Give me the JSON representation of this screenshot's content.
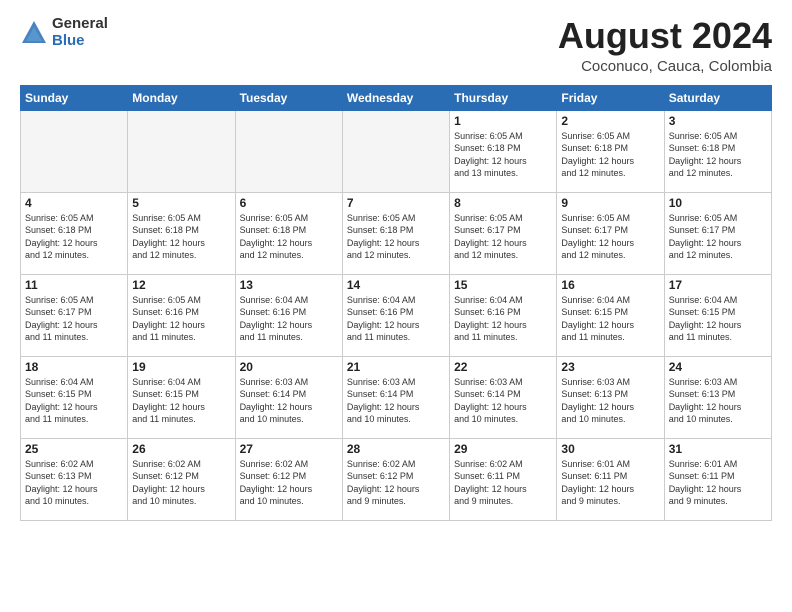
{
  "logo": {
    "general": "General",
    "blue": "Blue"
  },
  "title": "August 2024",
  "location": "Coconuco, Cauca, Colombia",
  "weekdays": [
    "Sunday",
    "Monday",
    "Tuesday",
    "Wednesday",
    "Thursday",
    "Friday",
    "Saturday"
  ],
  "weeks": [
    [
      {
        "day": "",
        "text": ""
      },
      {
        "day": "",
        "text": ""
      },
      {
        "day": "",
        "text": ""
      },
      {
        "day": "",
        "text": ""
      },
      {
        "day": "1",
        "text": "Sunrise: 6:05 AM\nSunset: 6:18 PM\nDaylight: 12 hours\nand 13 minutes."
      },
      {
        "day": "2",
        "text": "Sunrise: 6:05 AM\nSunset: 6:18 PM\nDaylight: 12 hours\nand 12 minutes."
      },
      {
        "day": "3",
        "text": "Sunrise: 6:05 AM\nSunset: 6:18 PM\nDaylight: 12 hours\nand 12 minutes."
      }
    ],
    [
      {
        "day": "4",
        "text": "Sunrise: 6:05 AM\nSunset: 6:18 PM\nDaylight: 12 hours\nand 12 minutes."
      },
      {
        "day": "5",
        "text": "Sunrise: 6:05 AM\nSunset: 6:18 PM\nDaylight: 12 hours\nand 12 minutes."
      },
      {
        "day": "6",
        "text": "Sunrise: 6:05 AM\nSunset: 6:18 PM\nDaylight: 12 hours\nand 12 minutes."
      },
      {
        "day": "7",
        "text": "Sunrise: 6:05 AM\nSunset: 6:18 PM\nDaylight: 12 hours\nand 12 minutes."
      },
      {
        "day": "8",
        "text": "Sunrise: 6:05 AM\nSunset: 6:17 PM\nDaylight: 12 hours\nand 12 minutes."
      },
      {
        "day": "9",
        "text": "Sunrise: 6:05 AM\nSunset: 6:17 PM\nDaylight: 12 hours\nand 12 minutes."
      },
      {
        "day": "10",
        "text": "Sunrise: 6:05 AM\nSunset: 6:17 PM\nDaylight: 12 hours\nand 12 minutes."
      }
    ],
    [
      {
        "day": "11",
        "text": "Sunrise: 6:05 AM\nSunset: 6:17 PM\nDaylight: 12 hours\nand 11 minutes."
      },
      {
        "day": "12",
        "text": "Sunrise: 6:05 AM\nSunset: 6:16 PM\nDaylight: 12 hours\nand 11 minutes."
      },
      {
        "day": "13",
        "text": "Sunrise: 6:04 AM\nSunset: 6:16 PM\nDaylight: 12 hours\nand 11 minutes."
      },
      {
        "day": "14",
        "text": "Sunrise: 6:04 AM\nSunset: 6:16 PM\nDaylight: 12 hours\nand 11 minutes."
      },
      {
        "day": "15",
        "text": "Sunrise: 6:04 AM\nSunset: 6:16 PM\nDaylight: 12 hours\nand 11 minutes."
      },
      {
        "day": "16",
        "text": "Sunrise: 6:04 AM\nSunset: 6:15 PM\nDaylight: 12 hours\nand 11 minutes."
      },
      {
        "day": "17",
        "text": "Sunrise: 6:04 AM\nSunset: 6:15 PM\nDaylight: 12 hours\nand 11 minutes."
      }
    ],
    [
      {
        "day": "18",
        "text": "Sunrise: 6:04 AM\nSunset: 6:15 PM\nDaylight: 12 hours\nand 11 minutes."
      },
      {
        "day": "19",
        "text": "Sunrise: 6:04 AM\nSunset: 6:15 PM\nDaylight: 12 hours\nand 11 minutes."
      },
      {
        "day": "20",
        "text": "Sunrise: 6:03 AM\nSunset: 6:14 PM\nDaylight: 12 hours\nand 10 minutes."
      },
      {
        "day": "21",
        "text": "Sunrise: 6:03 AM\nSunset: 6:14 PM\nDaylight: 12 hours\nand 10 minutes."
      },
      {
        "day": "22",
        "text": "Sunrise: 6:03 AM\nSunset: 6:14 PM\nDaylight: 12 hours\nand 10 minutes."
      },
      {
        "day": "23",
        "text": "Sunrise: 6:03 AM\nSunset: 6:13 PM\nDaylight: 12 hours\nand 10 minutes."
      },
      {
        "day": "24",
        "text": "Sunrise: 6:03 AM\nSunset: 6:13 PM\nDaylight: 12 hours\nand 10 minutes."
      }
    ],
    [
      {
        "day": "25",
        "text": "Sunrise: 6:02 AM\nSunset: 6:13 PM\nDaylight: 12 hours\nand 10 minutes."
      },
      {
        "day": "26",
        "text": "Sunrise: 6:02 AM\nSunset: 6:12 PM\nDaylight: 12 hours\nand 10 minutes."
      },
      {
        "day": "27",
        "text": "Sunrise: 6:02 AM\nSunset: 6:12 PM\nDaylight: 12 hours\nand 10 minutes."
      },
      {
        "day": "28",
        "text": "Sunrise: 6:02 AM\nSunset: 6:12 PM\nDaylight: 12 hours\nand 9 minutes."
      },
      {
        "day": "29",
        "text": "Sunrise: 6:02 AM\nSunset: 6:11 PM\nDaylight: 12 hours\nand 9 minutes."
      },
      {
        "day": "30",
        "text": "Sunrise: 6:01 AM\nSunset: 6:11 PM\nDaylight: 12 hours\nand 9 minutes."
      },
      {
        "day": "31",
        "text": "Sunrise: 6:01 AM\nSunset: 6:11 PM\nDaylight: 12 hours\nand 9 minutes."
      }
    ]
  ]
}
